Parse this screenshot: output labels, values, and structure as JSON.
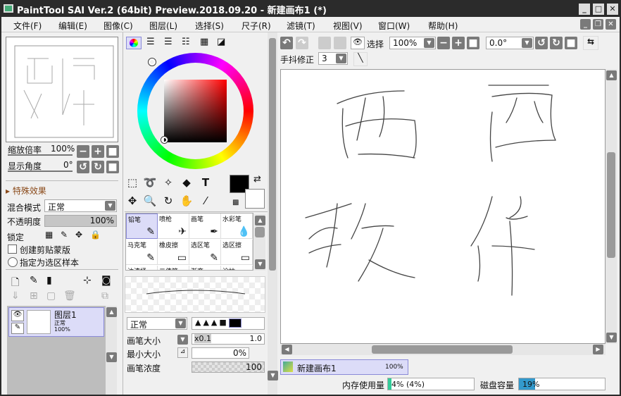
{
  "window": {
    "title": "PaintTool SAI Ver.2 (64bit) Preview.2018.09.20 - 新建画布1 (*)"
  },
  "menu": [
    "文件(F)",
    "编辑(E)",
    "图像(C)",
    "图层(L)",
    "选择(S)",
    "尺子(R)",
    "滤镜(T)",
    "视图(V)",
    "窗口(W)",
    "帮助(H)"
  ],
  "navigator": {
    "zoom_label": "缩放倍率",
    "zoom_value": "100%",
    "angle_label": "显示角度",
    "angle_value": "0°"
  },
  "layer_props": {
    "effects": "特殊效果",
    "blend_label": "混合模式",
    "blend_value": "正常",
    "opacity_label": "不透明度",
    "opacity_value": "100%",
    "lock_label": "锁定",
    "clip_label": "创建剪贴蒙版",
    "sample_label": "指定为选区样本"
  },
  "layers": [
    {
      "name": "图层1",
      "mode": "正常",
      "opacity": "100%"
    }
  ],
  "brushes": [
    "铅笔",
    "喷枪",
    "画笔",
    "水彩笔",
    "马克笔",
    "橡皮擦",
    "选区笔",
    "选区擦",
    "油漆桶",
    "二值笔",
    "渐变",
    "涂抹"
  ],
  "brush_settings": {
    "mode": "正常",
    "size_label": "画笔大小",
    "size_mult": "x0.1",
    "size_value": "1.0",
    "min_label": "最小大小",
    "min_value": "0%",
    "density_label": "画笔浓度",
    "density_value": "100"
  },
  "canvas_toolbar": {
    "select_label": "选择",
    "zoom": "100%",
    "angle": "0.0°",
    "stabilizer_label": "手抖修正",
    "stabilizer_value": "3"
  },
  "documents": [
    {
      "name": "新建画布1",
      "zoom": "100%"
    }
  ],
  "status": {
    "memory_label": "内存使用量",
    "memory_value": "4% (4%)",
    "memory_fraction": 0.04,
    "disk_label": "磁盘容量",
    "disk_value": "19%"
  },
  "colors": {
    "selected_brush": "#dcdcf8",
    "title_bg": "#2b2b2b"
  }
}
